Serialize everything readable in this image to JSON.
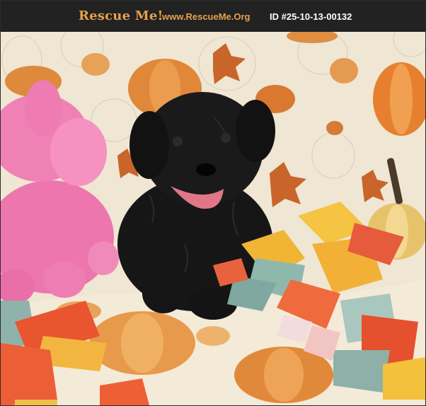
{
  "header": {
    "brand": "Rescue Me!",
    "site": "www.RescueMe.Org",
    "listing_id": "ID #25-10-13-00132"
  },
  "photo": {
    "subject": "black-puppy",
    "props": [
      "pink-plush-elephant",
      "fabric-scrap-pile",
      "autumn-pumpkin-blanket"
    ],
    "colors": {
      "header_bg": "#222222",
      "brand": "#e7a04c",
      "id_text": "#ffffff",
      "backdrop": "#efe7d6",
      "pumpkin": "#e08a3c",
      "plush": "#f07ab0",
      "fur": "#141414"
    }
  }
}
